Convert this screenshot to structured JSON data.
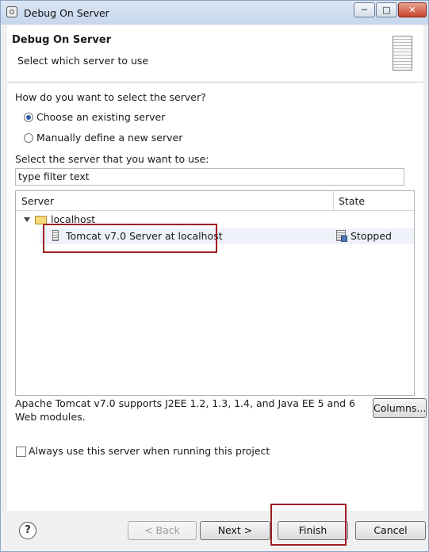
{
  "window": {
    "title": "Debug On Server",
    "controls": {
      "minimize": "─",
      "maximize": "□",
      "close": "✕"
    }
  },
  "header": {
    "title": "Debug On Server",
    "subtitle": "Select which server to use"
  },
  "selection": {
    "question": "How do you want to select the server?",
    "options": [
      {
        "label": "Choose an existing server",
        "selected": true
      },
      {
        "label": "Manually define a new server",
        "selected": false
      }
    ]
  },
  "server_list": {
    "label": "Select the server that you want to use:",
    "filter_placeholder": "type filter text",
    "columns": [
      "Server",
      "State"
    ],
    "tree": {
      "group": "localhost",
      "rows": [
        {
          "name": "Tomcat v7.0 Server at localhost",
          "state": "Stopped"
        }
      ]
    }
  },
  "description": "Apache Tomcat v7.0 supports J2EE 1.2, 1.3, 1.4, and Java EE 5 and 6 Web modules.",
  "columns_button": "Columns...",
  "always_use": {
    "label": "Always use this server when running this project",
    "checked": false
  },
  "buttons": {
    "help": "?",
    "back": "< Back",
    "next": "Next >",
    "finish": "Finish",
    "cancel": "Cancel"
  },
  "colors": {
    "highlight": "#9e1c22",
    "accent": "#2b5ea8"
  }
}
